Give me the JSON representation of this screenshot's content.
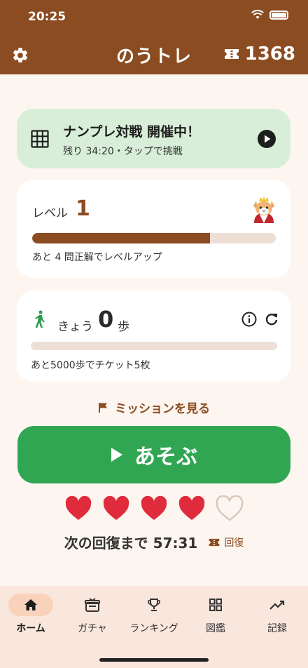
{
  "status_bar": {
    "time": "20:25"
  },
  "header": {
    "title": "のうトレ",
    "ticket_count": "1368"
  },
  "banner": {
    "title": "ナンプレ対戦 開催中！",
    "subtitle": "残り 34:20・タップで挑戦"
  },
  "level": {
    "label": "レベル",
    "value": "1",
    "progress": 0.73,
    "note": "あと 4 問正解でレベルアップ"
  },
  "steps": {
    "label": "きょう",
    "count": "0",
    "unit": "歩",
    "progress": 0,
    "note": "あと5000歩でチケット5枚"
  },
  "mission": {
    "label": "ミッションを見る"
  },
  "play_button": {
    "label": "あそぶ"
  },
  "hearts": {
    "filled": 4,
    "total": 5,
    "filled_color": "#e02b3c",
    "empty_color": "#d8c9bd"
  },
  "recovery": {
    "label": "次の回復まで 57:31",
    "button_label": "回復"
  },
  "tabs": [
    {
      "label": "ホーム",
      "icon": "home-icon",
      "active": true
    },
    {
      "label": "ガチャ",
      "icon": "gacha-icon",
      "active": false
    },
    {
      "label": "ランキング",
      "icon": "trophy-icon",
      "active": false
    },
    {
      "label": "図鑑",
      "icon": "grid-icon",
      "active": false
    },
    {
      "label": "記録",
      "icon": "chart-icon",
      "active": false
    }
  ],
  "colors": {
    "brand_brown": "#8b4c22",
    "play_green": "#31a652",
    "banner_green": "#d8eed8",
    "background": "#fdf5ef"
  }
}
